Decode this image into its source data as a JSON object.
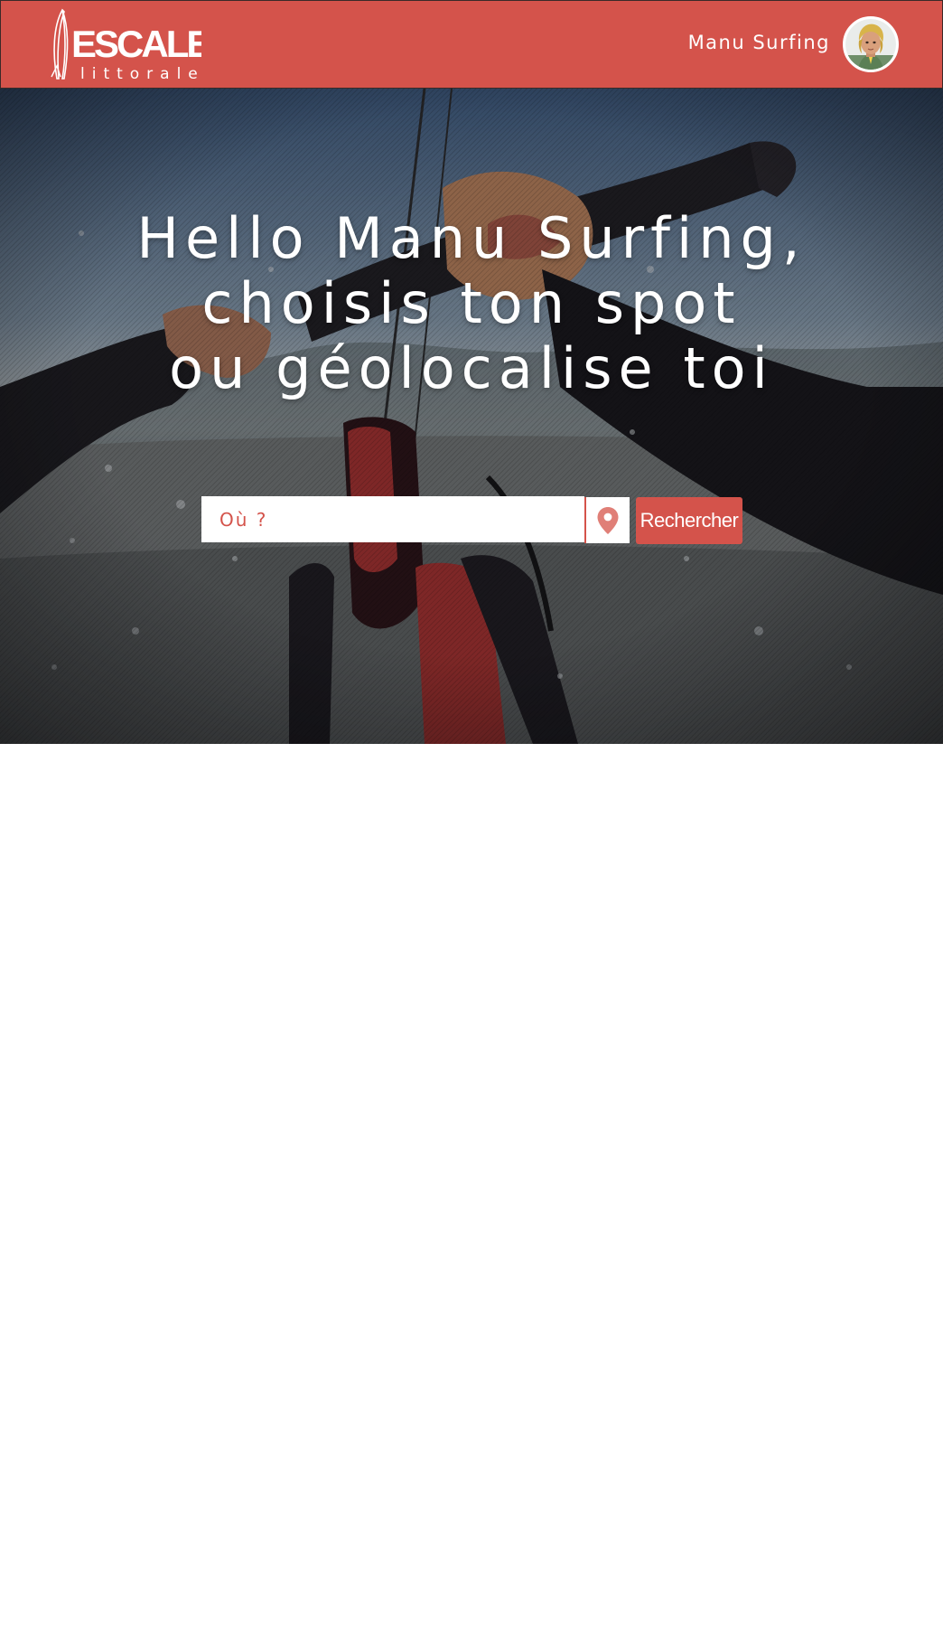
{
  "header": {
    "logo": {
      "brand": "ESCALE",
      "tagline": "littorale"
    },
    "user": {
      "name": "Manu Surfing",
      "avatar_icon": "user-avatar-photo"
    }
  },
  "hero": {
    "title_lines": [
      "Hello Manu Surfing,",
      "choisis ton spot",
      "ou géolocalise toi"
    ],
    "search": {
      "placeholder": "Où ?",
      "value": "",
      "geolocate_icon": "map-pin-icon",
      "submit_label": "Rechercher"
    }
  },
  "colors": {
    "brand": "#d4534b",
    "text_on_brand": "#ffffff",
    "page_background": "#ffffff"
  }
}
